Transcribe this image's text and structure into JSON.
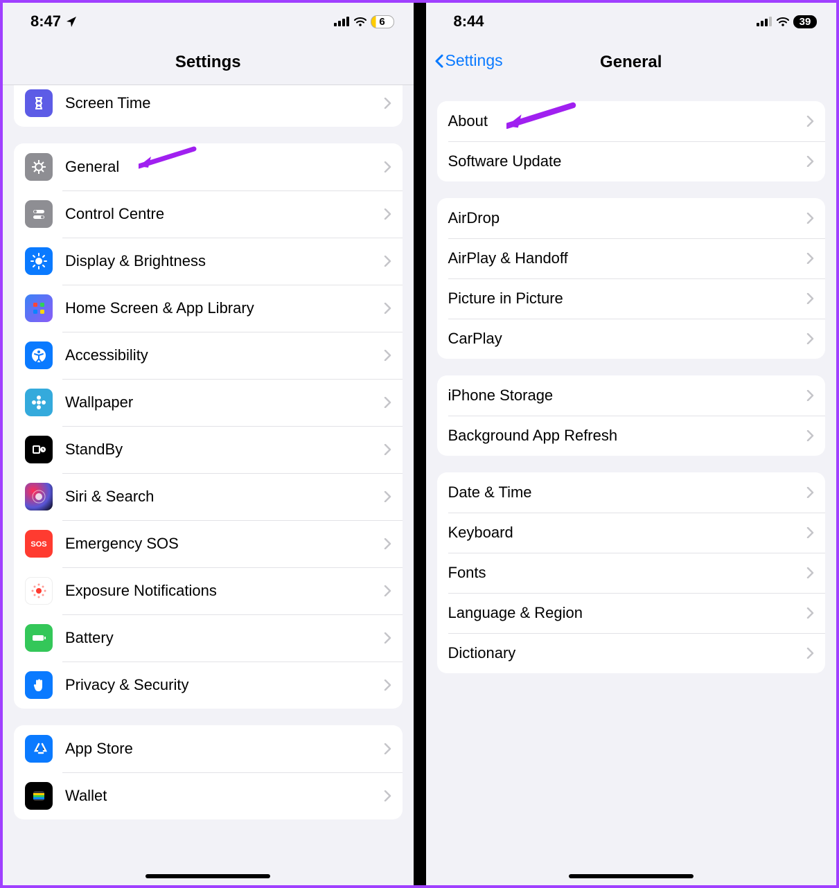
{
  "left": {
    "status": {
      "time": "8:47",
      "battery": "6"
    },
    "title": "Settings",
    "group_top": [
      {
        "id": "screentime",
        "label": "Screen Time",
        "icon": "hourglass-icon",
        "bg": "ic-screentime"
      }
    ],
    "group_main": [
      {
        "id": "general",
        "label": "General",
        "icon": "gear-icon",
        "bg": "ic-general",
        "annotated": true
      },
      {
        "id": "control-centre",
        "label": "Control Centre",
        "icon": "toggles-icon",
        "bg": "ic-control"
      },
      {
        "id": "display",
        "label": "Display & Brightness",
        "icon": "sun-icon",
        "bg": "ic-display"
      },
      {
        "id": "home-screen",
        "label": "Home Screen & App Library",
        "icon": "grid-icon",
        "bg": "ic-home"
      },
      {
        "id": "accessibility",
        "label": "Accessibility",
        "icon": "accessibility-icon",
        "bg": "ic-accessibility"
      },
      {
        "id": "wallpaper",
        "label": "Wallpaper",
        "icon": "flower-icon",
        "bg": "ic-wallpaper"
      },
      {
        "id": "standby",
        "label": "StandBy",
        "icon": "clock-icon",
        "bg": "ic-standby"
      },
      {
        "id": "siri",
        "label": "Siri & Search",
        "icon": "siri-icon",
        "bg": "ic-siri"
      },
      {
        "id": "sos",
        "label": "Emergency SOS",
        "icon": "sos-icon",
        "bg": "ic-sos"
      },
      {
        "id": "exposure",
        "label": "Exposure Notifications",
        "icon": "exposure-icon",
        "bg": "ic-exposure"
      },
      {
        "id": "battery",
        "label": "Battery",
        "icon": "battery-icon",
        "bg": "ic-battery"
      },
      {
        "id": "privacy",
        "label": "Privacy & Security",
        "icon": "hand-icon",
        "bg": "ic-privacy"
      }
    ],
    "group_store": [
      {
        "id": "appstore",
        "label": "App Store",
        "icon": "appstore-icon",
        "bg": "ic-appstore"
      },
      {
        "id": "wallet",
        "label": "Wallet",
        "icon": "wallet-icon",
        "bg": "ic-wallet"
      }
    ]
  },
  "right": {
    "status": {
      "time": "8:44",
      "battery": "39"
    },
    "back": "Settings",
    "title": "General",
    "groups": [
      [
        {
          "id": "about",
          "label": "About",
          "annotated": true
        },
        {
          "id": "software-update",
          "label": "Software Update"
        }
      ],
      [
        {
          "id": "airdrop",
          "label": "AirDrop"
        },
        {
          "id": "airplay",
          "label": "AirPlay & Handoff"
        },
        {
          "id": "pip",
          "label": "Picture in Picture"
        },
        {
          "id": "carplay",
          "label": "CarPlay"
        }
      ],
      [
        {
          "id": "storage",
          "label": "iPhone Storage"
        },
        {
          "id": "bg-refresh",
          "label": "Background App Refresh"
        }
      ],
      [
        {
          "id": "date-time",
          "label": "Date & Time"
        },
        {
          "id": "keyboard",
          "label": "Keyboard"
        },
        {
          "id": "fonts",
          "label": "Fonts"
        },
        {
          "id": "language",
          "label": "Language & Region"
        },
        {
          "id": "dictionary",
          "label": "Dictionary"
        }
      ]
    ]
  }
}
